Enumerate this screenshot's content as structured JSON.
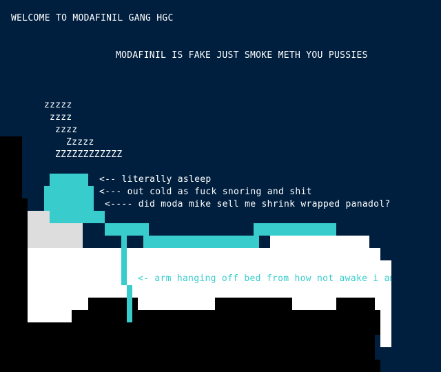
{
  "header": {
    "title": "WELCOME TO MODAFINIL GANG HGC",
    "subtitle": "MODAFINIL IS FAKE JUST SMOKE METH YOU PUSSIES"
  },
  "snore": [
    "zzzzz",
    "zzzz",
    "zzzz",
    "Zzzzz",
    "ZZZZZZZZZZZZ"
  ],
  "annotations": {
    "asleep": "<-- literally asleep",
    "out_cold": "<--- out cold as fuck snoring and shit",
    "panadol": "<---- did moda mike sell me shrink wrapped panadol?",
    "arm": "<- arm hanging off bed from how not awake i am"
  },
  "colors": {
    "background": "#001f3f",
    "body": "#39cccc",
    "bed": "#ffffff",
    "shadow": "#000000",
    "pillow": "#dddddd"
  }
}
